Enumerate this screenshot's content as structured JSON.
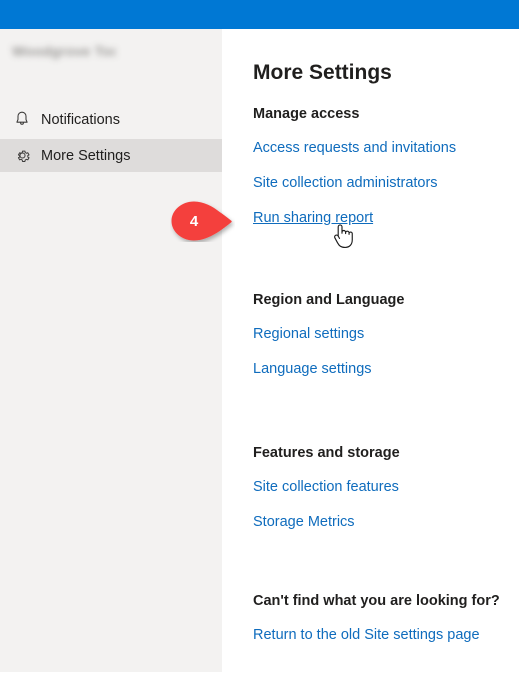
{
  "suite_bar": {
    "color": "#0078d4"
  },
  "sidebar": {
    "site_title": "Woodgrove Toolkit",
    "items": [
      {
        "label": "Notifications",
        "icon": "bell-icon",
        "selected": false
      },
      {
        "label": "More Settings",
        "icon": "gear-icon",
        "selected": true
      }
    ]
  },
  "main": {
    "title": "More Settings",
    "groups": [
      {
        "heading": "Manage access",
        "links": [
          "Access requests and invitations",
          "Site collection administrators",
          "Run sharing report"
        ]
      },
      {
        "heading": "Region and Language",
        "links": [
          "Regional settings",
          "Language settings"
        ]
      },
      {
        "heading": "Features and storage",
        "links": [
          "Site collection features",
          "Storage Metrics"
        ]
      },
      {
        "heading": "Can't find what you are looking for?",
        "links": [
          "Return to the old Site settings page"
        ]
      }
    ]
  },
  "callout": {
    "number": "4",
    "color": "#f4413c",
    "points_to": "Run sharing report"
  },
  "cursor": {
    "type": "pointer-hand-cursor"
  },
  "colors": {
    "accent_blue": "#0078d4",
    "link_blue": "#0f6cbd",
    "sidebar_bg": "#f3f2f1",
    "sidebar_selected_bg": "#dedcdb",
    "text_primary": "#201f1e",
    "callout_red": "#f4413c"
  }
}
